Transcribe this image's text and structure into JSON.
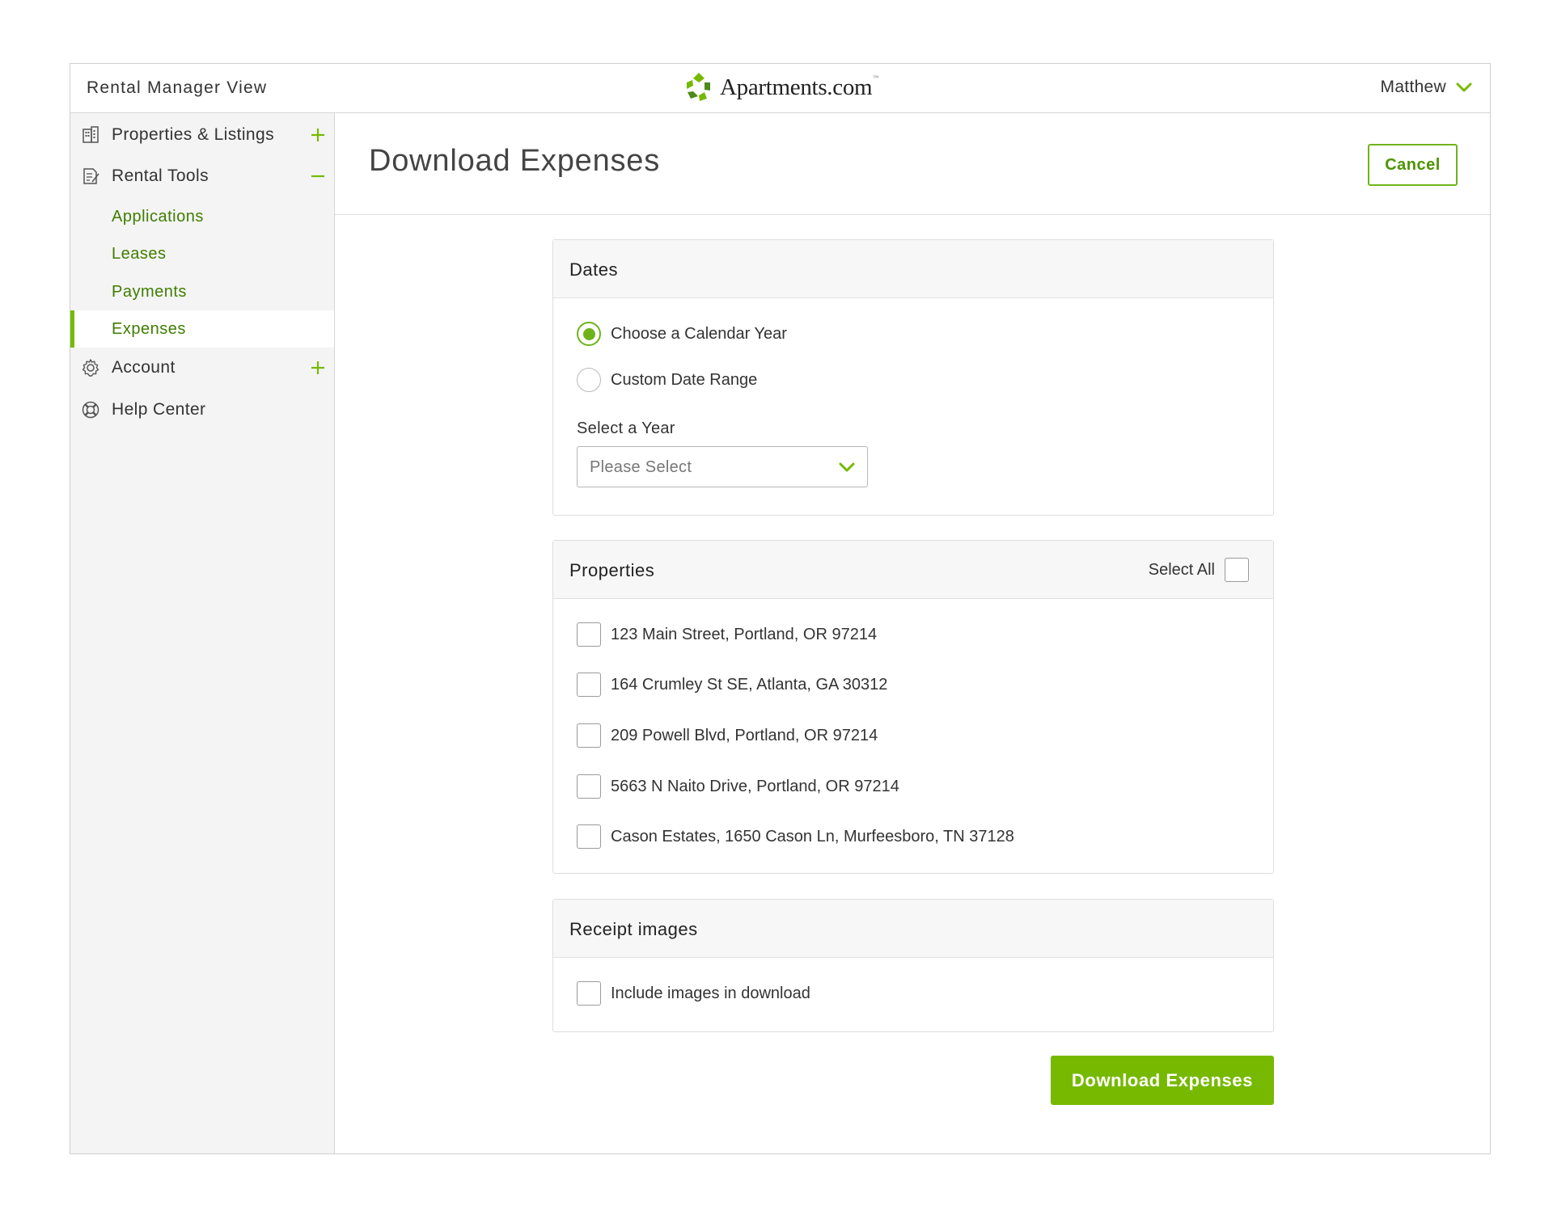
{
  "header": {
    "view_label": "Rental Manager View",
    "brand": "Apartments.com",
    "brand_tm": "™",
    "user_name": "Matthew"
  },
  "sidebar": {
    "items": [
      {
        "label": "Properties & Listings",
        "icon": "building-icon",
        "control": "plus"
      },
      {
        "label": "Rental Tools",
        "icon": "document-edit-icon",
        "control": "minus"
      },
      {
        "label": "Account",
        "icon": "gear-icon",
        "control": "plus"
      },
      {
        "label": "Help Center",
        "icon": "lifebuoy-icon"
      }
    ],
    "sub_items": [
      {
        "label": "Applications"
      },
      {
        "label": "Leases"
      },
      {
        "label": "Payments"
      },
      {
        "label": "Expenses",
        "active": true
      }
    ]
  },
  "main": {
    "title": "Download Expenses",
    "cancel_label": "Cancel",
    "dates": {
      "title": "Dates",
      "options": [
        "Choose a Calendar Year",
        "Custom Date Range"
      ],
      "selected_option": "Choose a Calendar Year",
      "year_label": "Select a Year",
      "year_placeholder": "Please Select"
    },
    "properties": {
      "title": "Properties",
      "select_all_label": "Select All",
      "items": [
        "123 Main Street, Portland, OR 97214",
        "164 Crumley St SE, Atlanta, GA 30312",
        "209 Powell Blvd, Portland, OR 97214",
        "5663 N Naito Drive, Portland, OR 97214",
        "Cason Estates, 1650 Cason Ln, Murfeesboro, TN 37128"
      ]
    },
    "receipts": {
      "title": "Receipt images",
      "include_label": "Include images in download"
    },
    "download_label": "Download Expenses"
  },
  "colors": {
    "accent": "#76b900",
    "accent_dark": "#3f7d00",
    "sidebar_bg": "#f4f4f4",
    "border": "#d6d6d6"
  }
}
